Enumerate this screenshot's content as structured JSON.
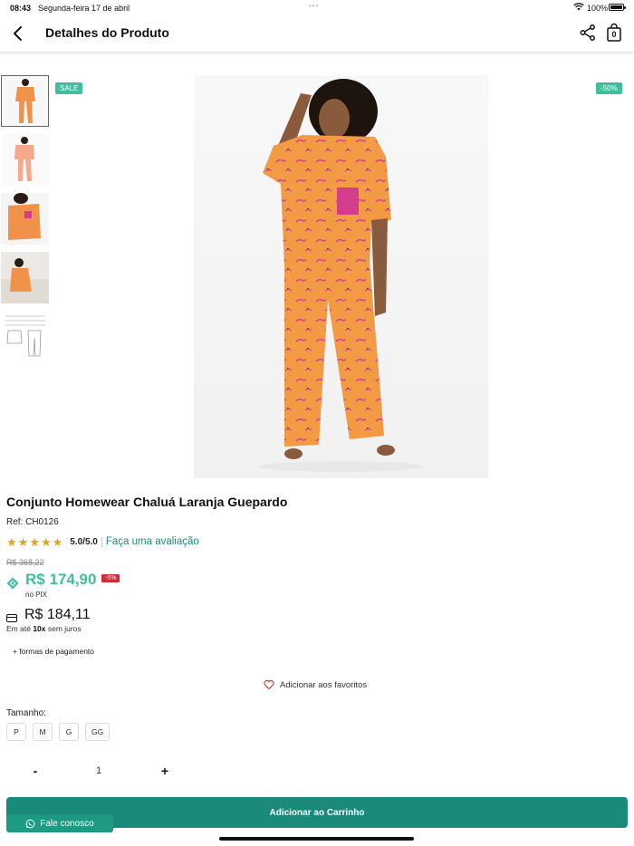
{
  "status_bar": {
    "time": "08:43",
    "date": "Segunda-feira 17 de abril",
    "battery": "100%"
  },
  "navbar": {
    "title": "Detalhes do Produto",
    "cart_count": "0"
  },
  "gallery": {
    "sale_badge": "SALE",
    "discount_badge": "-50%",
    "thumbnails": [
      "front-view",
      "back-view",
      "detail-view",
      "lifestyle-view",
      "size-chart"
    ],
    "selected_thumbnail": "front-view"
  },
  "product": {
    "name": "Conjunto Homewear Chaluá Laranja Guepardo",
    "ref": "Ref: CH0126",
    "rating": 5,
    "rating_text": "5.0/5.0",
    "review_link": "Faça uma avaliação"
  },
  "pricing": {
    "old_price": "R$ 368,22",
    "pix_price": "R$ 174,90",
    "pix_discount": "-5%",
    "pix_label": "no PIX",
    "card_price": "R$ 184,11",
    "installments_prefix": "Em até",
    "installments_count": "10x",
    "installments_suffix": "sem juros",
    "payment_link": "+ formas de pagamento"
  },
  "favorite": {
    "label": "Adicionar aos favoritos"
  },
  "sizes": {
    "label": "Tamanho:",
    "options": [
      "P",
      "M",
      "G",
      "GG"
    ]
  },
  "quantity": {
    "minus": "-",
    "value": "1",
    "plus": "+"
  },
  "actions": {
    "add_to_cart": "Adicionar ao Carrinho",
    "chat": "Fale conosco"
  },
  "colors": {
    "accent": "#1a8a7a",
    "badge": "#3fbf9f",
    "pix": "#3fbf9f",
    "discount": "#d22a3a",
    "stars": "#e2a320"
  }
}
